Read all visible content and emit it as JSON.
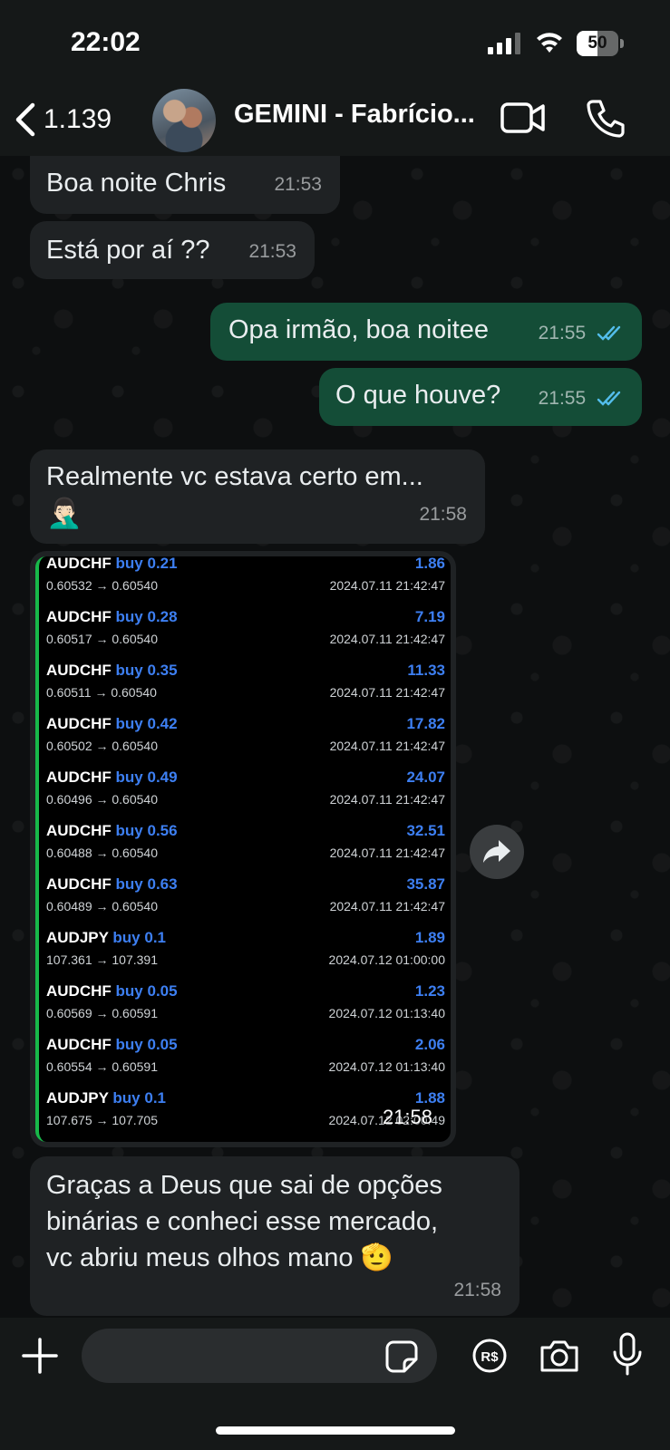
{
  "status_bar": {
    "time": "22:02",
    "battery": "50",
    "battery_level": 0.5
  },
  "header": {
    "back_count": "1.139",
    "title": "GEMINI - Fabrício..."
  },
  "messages": [
    {
      "direction": "in",
      "text": "Boa noite Chris",
      "time": "21:53"
    },
    {
      "direction": "in",
      "text": "Está por aí ??",
      "time": "21:53"
    },
    {
      "direction": "out",
      "text": "Opa irmão, boa noitee",
      "time": "21:55",
      "status": "read"
    },
    {
      "direction": "out",
      "text": "O que houve?",
      "time": "21:55",
      "status": "read"
    },
    {
      "direction": "in",
      "text": "Realmente vc estava certo em...",
      "emoji": "🤦🏻‍♂️",
      "time": "21:58"
    },
    {
      "direction": "in",
      "type": "image",
      "time": "21:58"
    },
    {
      "direction": "in",
      "text_lines": [
        "Graças a Deus que sai de opções",
        "binárias e conheci esse mercado,",
        "vc abriu meus olhos mano 🫡"
      ],
      "time": "21:58"
    }
  ],
  "trades": [
    {
      "symbol": "AUDCHF",
      "side": "buy",
      "lot": "0.21",
      "prices": "0.60532 → 0.60540",
      "profit": "1.86",
      "date": "2024.07.11 21:42:47"
    },
    {
      "symbol": "AUDCHF",
      "side": "buy",
      "lot": "0.28",
      "prices": "0.60517 → 0.60540",
      "profit": "7.19",
      "date": "2024.07.11 21:42:47"
    },
    {
      "symbol": "AUDCHF",
      "side": "buy",
      "lot": "0.35",
      "prices": "0.60511 → 0.60540",
      "profit": "11.33",
      "date": "2024.07.11 21:42:47"
    },
    {
      "symbol": "AUDCHF",
      "side": "buy",
      "lot": "0.42",
      "prices": "0.60502 → 0.60540",
      "profit": "17.82",
      "date": "2024.07.11 21:42:47"
    },
    {
      "symbol": "AUDCHF",
      "side": "buy",
      "lot": "0.49",
      "prices": "0.60496 → 0.60540",
      "profit": "24.07",
      "date": "2024.07.11 21:42:47"
    },
    {
      "symbol": "AUDCHF",
      "side": "buy",
      "lot": "0.56",
      "prices": "0.60488 → 0.60540",
      "profit": "32.51",
      "date": "2024.07.11 21:42:47"
    },
    {
      "symbol": "AUDCHF",
      "side": "buy",
      "lot": "0.63",
      "prices": "0.60489 → 0.60540",
      "profit": "35.87",
      "date": "2024.07.11 21:42:47"
    },
    {
      "symbol": "AUDJPY",
      "side": "buy",
      "lot": "0.1",
      "prices": "107.361 → 107.391",
      "profit": "1.89",
      "date": "2024.07.12 01:00:00"
    },
    {
      "symbol": "AUDCHF",
      "side": "buy",
      "lot": "0.05",
      "prices": "0.60569 → 0.60591",
      "profit": "1.23",
      "date": "2024.07.12 01:13:40"
    },
    {
      "symbol": "AUDCHF",
      "side": "buy",
      "lot": "0.05",
      "prices": "0.60554 → 0.60591",
      "profit": "2.06",
      "date": "2024.07.12 01:13:40"
    },
    {
      "symbol": "AUDJPY",
      "side": "buy",
      "lot": "0.1",
      "prices": "107.675 → 107.705",
      "profit": "1.88",
      "date": "2024.07.12 02:00:49"
    }
  ],
  "input": {
    "placeholder": ""
  },
  "icons": {
    "back": "chevron-left-icon",
    "video": "video-camera-icon",
    "phone": "phone-icon",
    "forward": "forward-arrow-icon",
    "attach": "plus-icon",
    "sticker": "sticker-icon",
    "payment": "real-currency-icon",
    "camera": "camera-icon",
    "mic": "microphone-icon"
  },
  "colors": {
    "outgoing_bubble": "#144d37",
    "incoming_bubble": "#1f2224",
    "read_ticks": "#53bdeb",
    "trade_blue": "#3d7ff2",
    "trade_accent": "#18b84a"
  }
}
